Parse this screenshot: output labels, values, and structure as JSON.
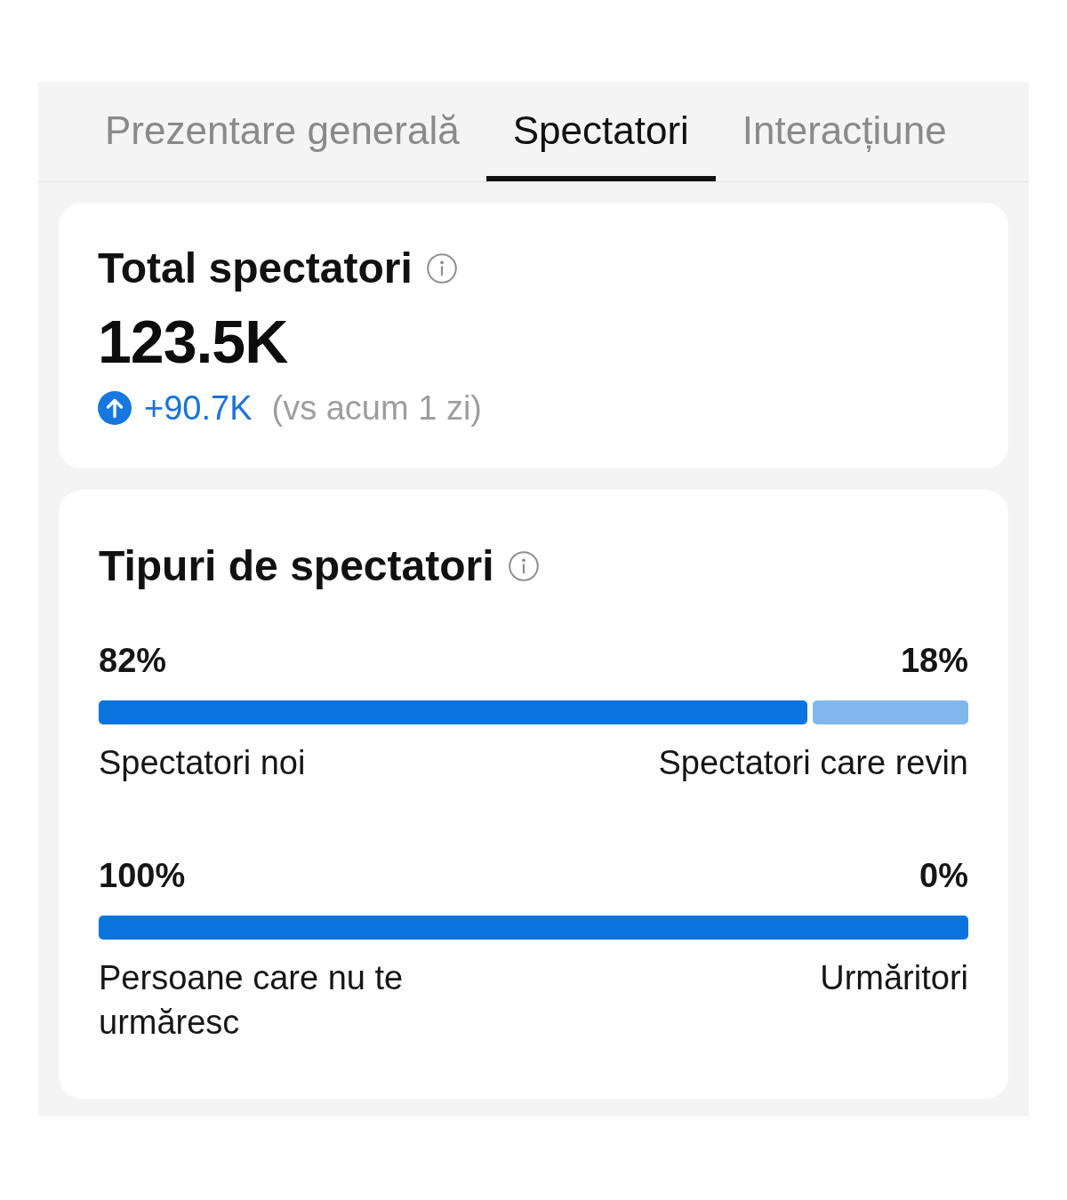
{
  "tabs": [
    {
      "label": "Prezentare generală",
      "selected": false
    },
    {
      "label": "Spectatori",
      "selected": true
    },
    {
      "label": "Interacțiune",
      "selected": false
    }
  ],
  "total_card": {
    "title": "Total spectatori",
    "value": "123.5K",
    "change": {
      "increase": true,
      "amount": "+90.7K",
      "comparison": "(vs acum 1 zi)"
    }
  },
  "types_card": {
    "title": "Tipuri de spectatori",
    "rows": [
      {
        "left_value": "82%",
        "right_value": "18%",
        "level": 0.82,
        "left_label": "Spectatori noi",
        "right_label": "Spectatori care revin"
      },
      {
        "left_value": "100%",
        "right_value": "0%",
        "level": 1,
        "left_label": "Persoane care nu te urmăresc",
        "right_label": "Urmăritori"
      }
    ]
  }
}
